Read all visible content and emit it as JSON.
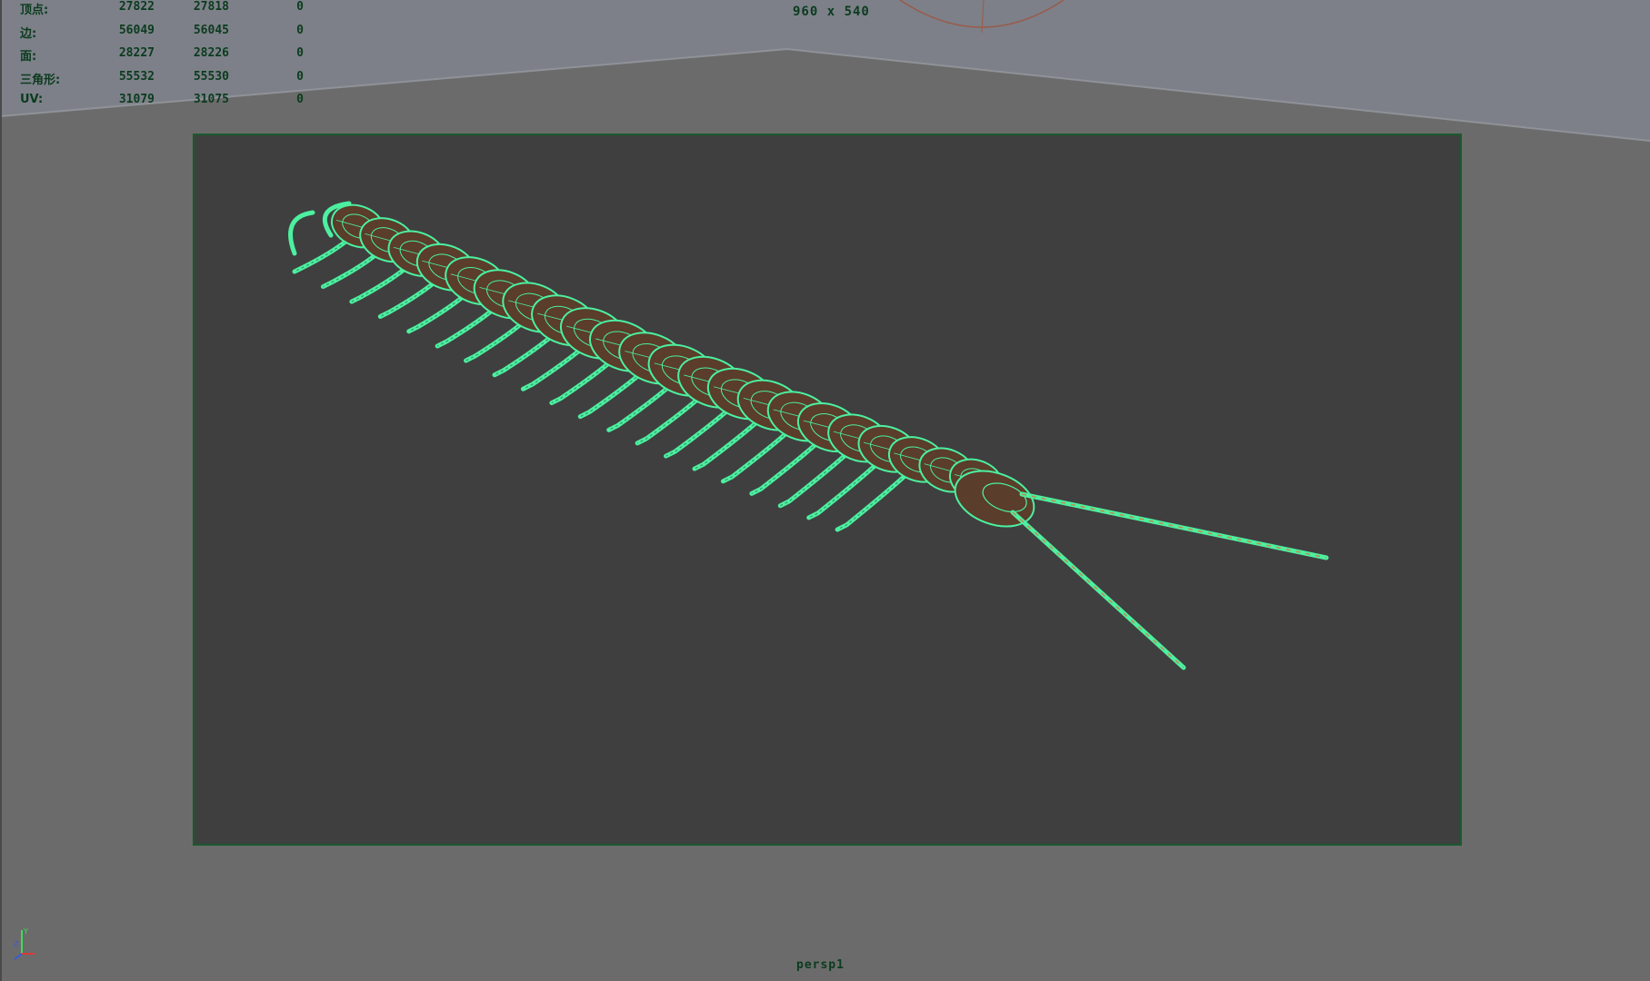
{
  "hud": {
    "stats": [
      {
        "label": "顶点:",
        "v1": "27822",
        "v2": "27818",
        "v3": "0"
      },
      {
        "label": "边:",
        "v1": "56049",
        "v2": "56045",
        "v3": "0"
      },
      {
        "label": "面:",
        "v1": "28227",
        "v2": "28226",
        "v3": "0"
      },
      {
        "label": "三角形:",
        "v1": "55532",
        "v2": "55530",
        "v3": "0"
      },
      {
        "label": "UV:",
        "v1": "31079",
        "v2": "31075",
        "v3": "0"
      }
    ],
    "resolution": "960 x 540",
    "camera": "persp1"
  },
  "axis": {
    "z": "Z",
    "y": "Y"
  },
  "colors": {
    "viewport_bg": "#6b6b6b",
    "sky_bg": "#7d8088",
    "gate_bg": "#3f3f3f",
    "wireframe": "#4cf0a0",
    "body_fill": "#5a3d2a",
    "hud_text": "#0b3b1e"
  }
}
